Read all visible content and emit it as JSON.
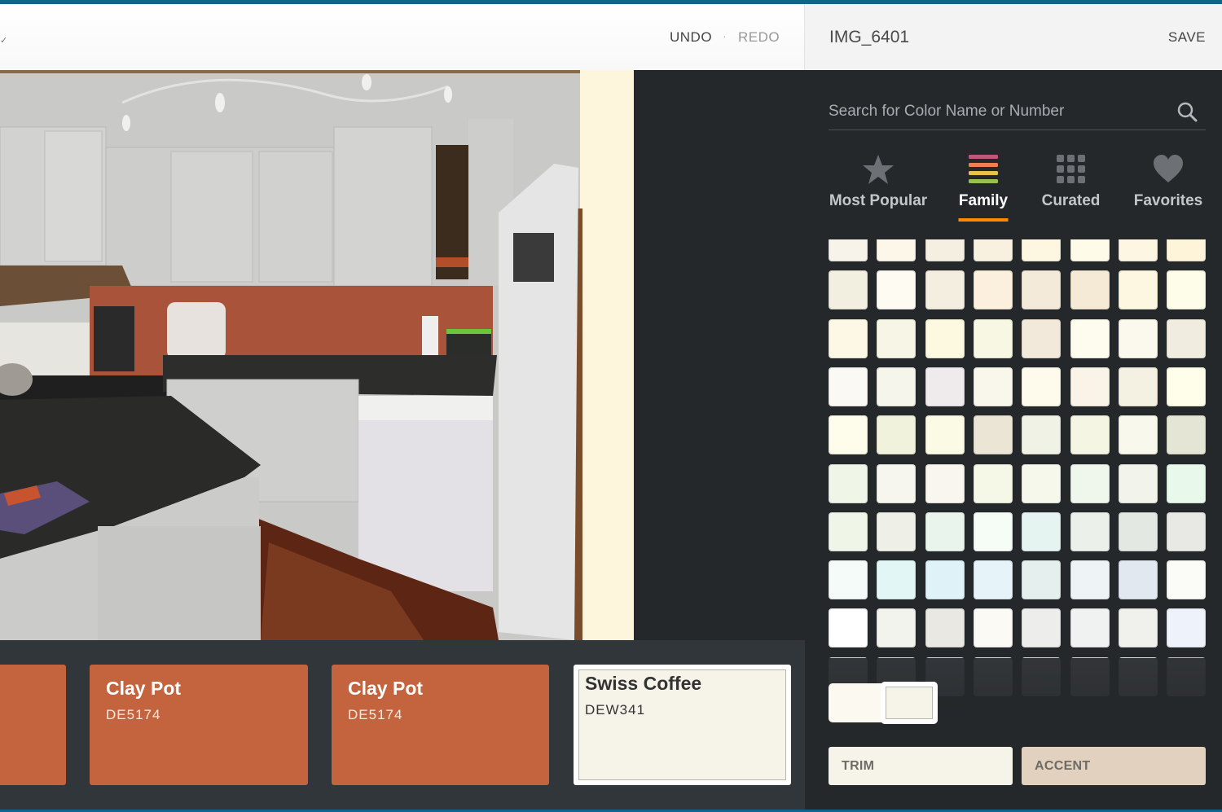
{
  "header": {
    "undo_label": "UNDO",
    "separator": "·",
    "redo_label": "REDO",
    "image_title": "IMG_6401",
    "save_label": "SAVE",
    "chevron": "✓"
  },
  "colors": {
    "accent_bar": "#0d6685",
    "active_tab_underline": "#ff8a00",
    "clay_pot": "#c4643f",
    "swiss_coffee": "#f6f4e8",
    "trim_button": "#f6f4e8",
    "accent_button": "#e3d1bf"
  },
  "color_bar": {
    "chips": [
      {
        "name": "",
        "code": "",
        "partial": true
      },
      {
        "name": "Clay Pot",
        "code": "DE5174"
      },
      {
        "name": "Clay Pot",
        "code": "DE5174"
      },
      {
        "name": "Swiss Coffee",
        "code": "DEW341",
        "selected": true
      }
    ]
  },
  "search": {
    "placeholder": "Search for Color Name or Number",
    "icon": "search-icon"
  },
  "tabs": [
    {
      "label": "Most Popular",
      "icon": "star-icon",
      "active": false
    },
    {
      "label": "Family",
      "icon": "color-stripes-icon",
      "active": true
    },
    {
      "label": "Curated",
      "icon": "grid-dots-icon",
      "active": false
    },
    {
      "label": "Favorites",
      "icon": "heart-icon",
      "active": false
    }
  ],
  "swatches": [
    [
      "#f7f2ea",
      "#fdf7ea",
      "#f4efe0",
      "#f8f1e0",
      "#fdf7e2",
      "#fefce8",
      "#fcf6e2",
      "#fdf4da"
    ],
    [
      "#f2eee0",
      "#fefcf2",
      "#f4eee0",
      "#faf0dd",
      "#f4eada",
      "#f5ead5",
      "#fdf7e1",
      "#fefde9"
    ],
    [
      "#fdf8e6",
      "#f7f6e6",
      "#fdf9e0",
      "#f8f7e3",
      "#f3e9da",
      "#fefcef",
      "#fbf8ee",
      "#f1ece0"
    ],
    [
      "#fbf9f4",
      "#f5f5ec",
      "#efeaec",
      "#f9f6ec",
      "#fefaec",
      "#f9f3e8",
      "#f5f1e2",
      "#fefeea"
    ],
    [
      "#fefcea",
      "#f1f2dc",
      "#fbfbe5",
      "#ebe5d5",
      "#f0f2e5",
      "#f5f5e3",
      "#f8f8ec",
      "#e5e5d6"
    ],
    [
      "#eff6e8",
      "#f6f6ef",
      "#f8f6ef",
      "#f5f7e7",
      "#f7f8ec",
      "#eff6eb",
      "#f2f4ec",
      "#e8f8eb"
    ],
    [
      "#eff6e8",
      "#eeefe7",
      "#e9f5ec",
      "#f5fdf6",
      "#e5f4f1",
      "#ebf0eb",
      "#e3e8e3",
      "#e8e9e4"
    ],
    [
      "#f4fbf8",
      "#e2f6f5",
      "#def2f7",
      "#e6f4fa",
      "#e5efee",
      "#eef4f6",
      "#e1e8ef",
      "#fbfbf8"
    ],
    [
      "#ffffff",
      "#f3f3ed",
      "#e9e8e3",
      "#fbfaf5",
      "#edeeeb",
      "#f0f2f1",
      "#f0f0ed",
      "#eef2fb"
    ],
    [
      "#e3e9ec",
      "#e6ebee",
      "#e5eaf5",
      "#eeeff2",
      "#e9e8e6",
      "#e6e4e5",
      "#f3f3f2",
      "#d6d4cf"
    ],
    [
      "#2a2d31",
      "#2b2e32",
      "#2c2f33",
      "#2b2e31",
      "#2b2d30",
      "#2b2e31",
      "#2b2e31",
      "#2c2c2f"
    ]
  ],
  "compare": {
    "left_color": "#fcf9f0",
    "right_color": "#f6f4e8"
  },
  "role_buttons": [
    {
      "label": "TRIM",
      "color": "#f6f4e8"
    },
    {
      "label": "ACCENT",
      "color": "#e3d1bf"
    }
  ]
}
